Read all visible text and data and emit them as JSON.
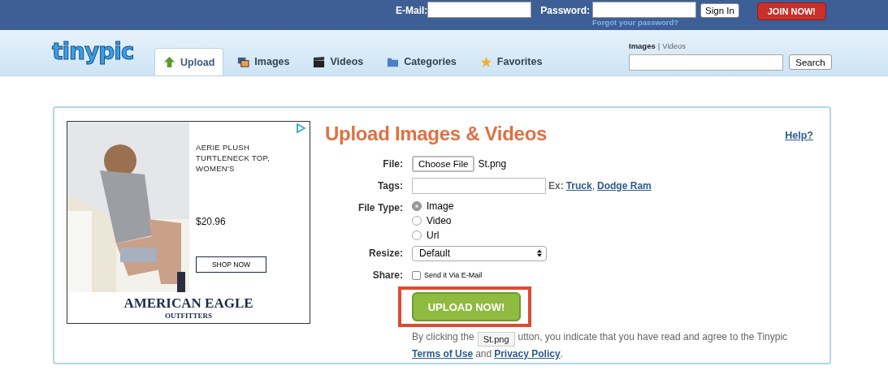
{
  "topbar": {
    "email_label": "E-Mail:",
    "password_label": "Password:",
    "forgot_link": "Forgot your password?",
    "sign_in": "Sign In",
    "join": "JOIN NOW!"
  },
  "logo": "tinypic",
  "tabs": [
    {
      "label": "Upload",
      "kind": "upload",
      "selected": true
    },
    {
      "label": "Images",
      "kind": "images",
      "selected": false
    },
    {
      "label": "Videos",
      "kind": "videos",
      "selected": false
    },
    {
      "label": "Categories",
      "kind": "categories",
      "selected": false
    },
    {
      "label": "Favorites",
      "kind": "favorites",
      "selected": false
    }
  ],
  "search": {
    "scopes": [
      {
        "label": "Images",
        "selected": true
      },
      {
        "label": "Videos",
        "selected": false
      }
    ],
    "separator": "|",
    "button": "Search"
  },
  "ad": {
    "headline": "AERIE PLUSH TURTLENECK TOP, WOMEN'S",
    "price": "$20.96",
    "cta": "SHOP NOW",
    "brand": "AMERICAN EAGLE",
    "brand_sub": "OUTFITTERS"
  },
  "form": {
    "title": "Upload Images & Videos",
    "help": "Help?",
    "file": {
      "label": "File:",
      "button": "Choose File",
      "filename": "St.png"
    },
    "tags": {
      "label": "Tags:",
      "ex": "Ex:",
      "links": [
        "Truck",
        "Dodge Ram"
      ],
      "separator": ","
    },
    "file_type": {
      "label": "File Type:",
      "options": [
        {
          "label": "Image",
          "selected": true
        },
        {
          "label": "Video",
          "selected": false
        },
        {
          "label": "Url",
          "selected": false
        }
      ]
    },
    "resize": {
      "label": "Resize:",
      "value": "Default"
    },
    "share": {
      "label": "Share:",
      "option": "Send it Via E-Mail",
      "checked": false
    },
    "upload_button": "UPLOAD NOW!",
    "highlighted": true,
    "terms": {
      "text_before": "By clicking the",
      "text_after": "utton, you indicate that you have read and agree to the Tinypic",
      "link1": "Terms of Use",
      "and": "and",
      "link2": "Privacy Policy",
      "end": "."
    },
    "tooltip": "St.png"
  }
}
